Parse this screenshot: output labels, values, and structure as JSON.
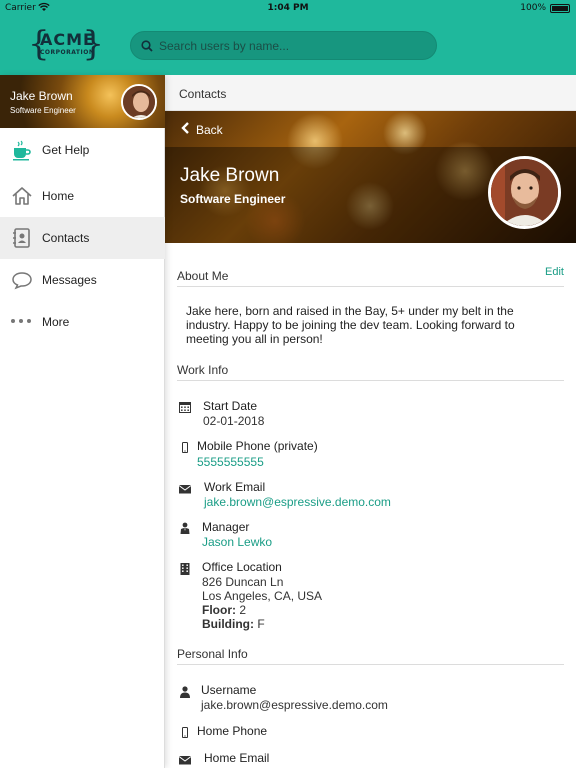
{
  "status_bar": {
    "carrier": "Carrier",
    "time": "1:04 PM",
    "battery": "100%"
  },
  "header": {
    "logo_name": "ACME",
    "logo_sub": "CORPORATION",
    "search_placeholder": "Search users by name...",
    "accent_color": "#1fb89c"
  },
  "sidebar": {
    "user_name": "Jake Brown",
    "user_title": "Software Engineer",
    "items": [
      {
        "label": "Get Help",
        "icon": "coffee-cup-icon"
      },
      {
        "label": "Home",
        "icon": "home-icon"
      },
      {
        "label": "Contacts",
        "icon": "address-book-icon",
        "active": true
      },
      {
        "label": "Messages",
        "icon": "chat-bubble-icon"
      },
      {
        "label": "More",
        "icon": "ellipsis-icon"
      }
    ]
  },
  "main": {
    "subheader_title": "Contacts",
    "back_label": "Back",
    "profile_name": "Jake Brown",
    "profile_title": "Software Engineer",
    "about": {
      "title": "About Me",
      "edit_label": "Edit",
      "text": "Jake here, born and raised in the Bay, 5+ under my belt in the industry. Happy to be joining the dev team. Looking forward to meeting you all in person!"
    },
    "work_info": {
      "title": "Work Info",
      "start_date_label": "Start Date",
      "start_date": "02-01-2018",
      "mobile_label": "Mobile Phone (private)",
      "mobile": "5555555555",
      "work_email_label": "Work Email",
      "work_email": "jake.brown@espressive.demo.com",
      "manager_label": "Manager",
      "manager": "Jason Lewko",
      "office_label": "Office Location",
      "office_line1": "826 Duncan Ln",
      "office_line2": "Los Angeles, CA, USA",
      "floor_label": "Floor:",
      "floor": "2",
      "building_label": "Building:",
      "building": "F"
    },
    "personal_info": {
      "title": "Personal Info",
      "username_label": "Username",
      "username": "jake.brown@espressive.demo.com",
      "home_phone_label": "Home Phone",
      "home_email_label": "Home Email"
    }
  },
  "colors": {
    "accent": "#1fb89c",
    "link": "#1a9d86"
  }
}
